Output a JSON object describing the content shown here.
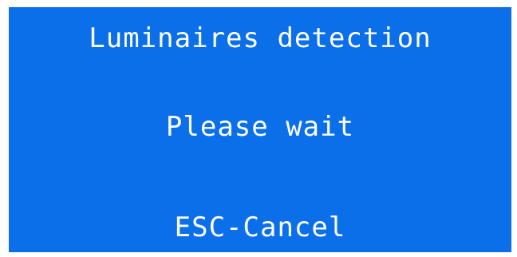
{
  "screen": {
    "title": "Luminaires detection",
    "status": "Please wait",
    "hint": "ESC-Cancel",
    "colors": {
      "background": "#0a6fe9",
      "text": "#ffffff",
      "border": "#ffffff"
    }
  }
}
